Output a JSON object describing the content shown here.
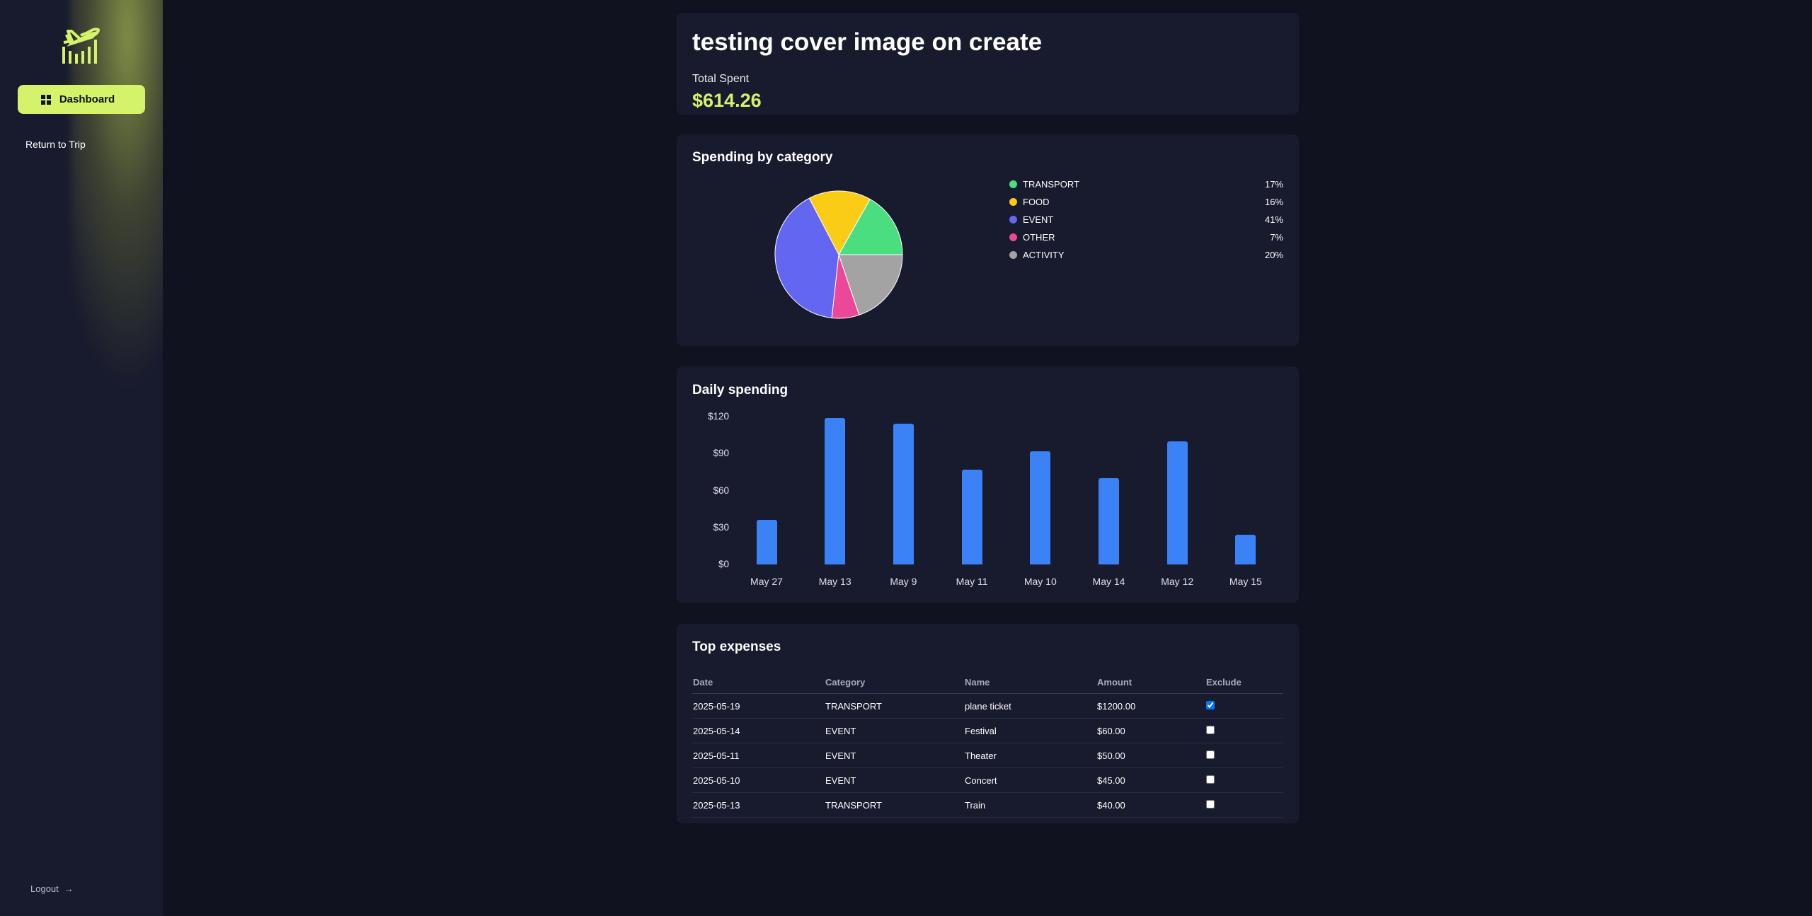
{
  "sidebar": {
    "dashboard_label": "Dashboard",
    "return_label": "Return to Trip",
    "logout_label": "Logout",
    "logout_arrow": "→",
    "accent_color": "#d4f26a"
  },
  "summary": {
    "title": "testing cover image on create",
    "total_label": "Total Spent",
    "total_value": "$614.26"
  },
  "category_card": {
    "title": "Spending by category"
  },
  "daily_card": {
    "title": "Daily spending"
  },
  "chart_data": [
    {
      "type": "pie",
      "title": "Spending by category",
      "slices": [
        {
          "label": "TRANSPORT",
          "percent": 17,
          "percent_label": "17%",
          "color": "#4ade80"
        },
        {
          "label": "FOOD",
          "percent": 16,
          "percent_label": "16%",
          "color": "#facc15"
        },
        {
          "label": "EVENT",
          "percent": 41,
          "percent_label": "41%",
          "color": "#6366f1"
        },
        {
          "label": "OTHER",
          "percent": 7,
          "percent_label": "7%",
          "color": "#ec4899"
        },
        {
          "label": "ACTIVITY",
          "percent": 20,
          "percent_label": "20%",
          "color": "#a3a3a3"
        }
      ],
      "legend_position": "right"
    },
    {
      "type": "bar",
      "title": "Daily spending",
      "categories": [
        "May 27",
        "May 13",
        "May 9",
        "May 11",
        "May 10",
        "May 14",
        "May 12",
        "May 15"
      ],
      "values": [
        36,
        119,
        114,
        77,
        92,
        70,
        100,
        24
      ],
      "ylim": [
        0,
        120
      ],
      "yticks": [
        "$0",
        "$30",
        "$60",
        "$90",
        "$120"
      ],
      "ytick_values": [
        0,
        30,
        60,
        90,
        120
      ],
      "bar_color": "#3b82f6",
      "grid": false
    }
  ],
  "expenses": {
    "title": "Top expenses",
    "headers": {
      "date": "Date",
      "category": "Category",
      "name": "Name",
      "amount": "Amount",
      "exclude": "Exclude"
    },
    "rows": [
      {
        "date": "2025-05-19",
        "category": "TRANSPORT",
        "name": "plane ticket",
        "amount": "$1200.00",
        "excluded": true
      },
      {
        "date": "2025-05-14",
        "category": "EVENT",
        "name": "Festival",
        "amount": "$60.00",
        "excluded": false
      },
      {
        "date": "2025-05-11",
        "category": "EVENT",
        "name": "Theater",
        "amount": "$50.00",
        "excluded": false
      },
      {
        "date": "2025-05-10",
        "category": "EVENT",
        "name": "Concert",
        "amount": "$45.00",
        "excluded": false
      },
      {
        "date": "2025-05-13",
        "category": "TRANSPORT",
        "name": "Train",
        "amount": "$40.00",
        "excluded": false
      }
    ]
  }
}
